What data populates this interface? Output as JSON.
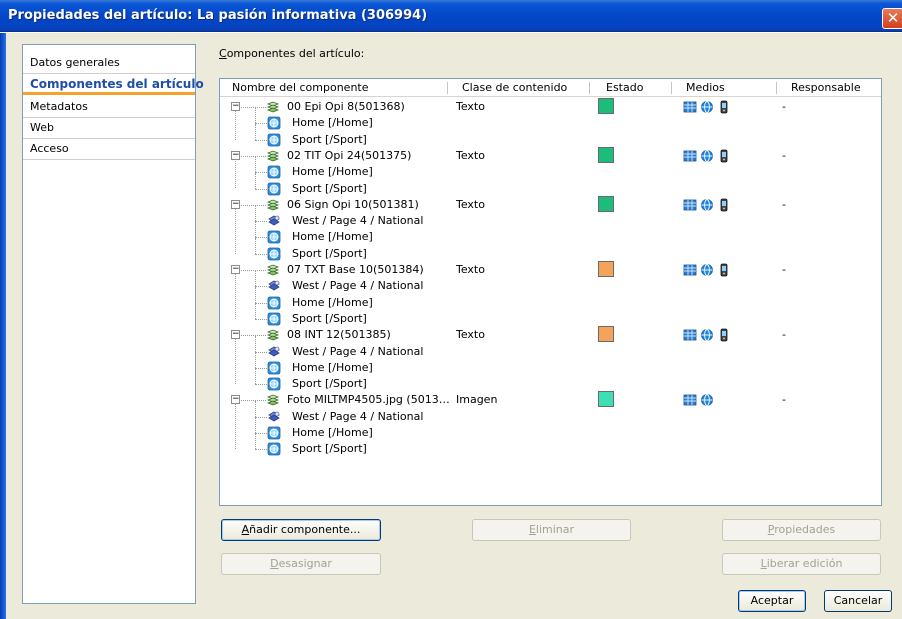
{
  "window": {
    "title": "Propiedades del artículo: La pasión informativa (306994)",
    "close_glyph": "✕"
  },
  "sidebar": {
    "items": [
      {
        "label": "Datos generales",
        "selected": false
      },
      {
        "label": "Componentes del artículo",
        "selected": true
      },
      {
        "label": "Metadatos",
        "selected": false
      },
      {
        "label": "Web",
        "selected": false
      },
      {
        "label": "Acceso",
        "selected": false
      }
    ]
  },
  "section": {
    "label_first": "C",
    "label_rest": "omponentes del artículo:"
  },
  "table": {
    "columns": [
      "Nombre del componente",
      "Clase de contenido",
      "Estado",
      "Medios",
      "Responsable"
    ],
    "rows": [
      {
        "type": "parent",
        "name": "00 Epi Opi 8(501368)",
        "content_class": "Texto",
        "status_color": "#1cbc7a",
        "media": [
          "grid-icon",
          "globe-icon",
          "mobile-icon"
        ],
        "responsable": "-"
      },
      {
        "type": "child",
        "name": "Home [/Home]",
        "icon": "web-icon"
      },
      {
        "type": "child",
        "name": "Sport [/Sport]",
        "icon": "web-icon"
      },
      {
        "type": "parent",
        "name": "02 TIT Opi 24(501375)",
        "content_class": "Texto",
        "status_color": "#1cbc7a",
        "media": [
          "grid-icon",
          "globe-icon",
          "mobile-icon"
        ],
        "responsable": "-"
      },
      {
        "type": "child",
        "name": "Home [/Home]",
        "icon": "web-icon"
      },
      {
        "type": "child",
        "name": "Sport [/Sport]",
        "icon": "web-icon"
      },
      {
        "type": "parent",
        "name": "06 Sign Opi 10(501381)",
        "content_class": "Texto",
        "status_color": "#1cbc7a",
        "media": [
          "grid-icon",
          "globe-icon",
          "mobile-icon"
        ],
        "responsable": "-"
      },
      {
        "type": "child",
        "name": "West / Page 4 / National",
        "icon": "page-icon"
      },
      {
        "type": "child",
        "name": "Home [/Home]",
        "icon": "web-icon"
      },
      {
        "type": "child",
        "name": "Sport [/Sport]",
        "icon": "web-icon"
      },
      {
        "type": "parent",
        "name": "07 TXT Base 10(501384)",
        "content_class": "Texto",
        "status_color": "#f4a35a",
        "media": [
          "grid-icon",
          "globe-icon",
          "mobile-icon"
        ],
        "responsable": "-"
      },
      {
        "type": "child",
        "name": "West / Page 4 / National",
        "icon": "page-icon"
      },
      {
        "type": "child",
        "name": "Home [/Home]",
        "icon": "web-icon"
      },
      {
        "type": "child",
        "name": "Sport [/Sport]",
        "icon": "web-icon"
      },
      {
        "type": "parent",
        "name": "08 INT 12(501385)",
        "content_class": "Texto",
        "status_color": "#f4a35a",
        "media": [
          "grid-icon",
          "globe-icon",
          "mobile-icon"
        ],
        "responsable": "-"
      },
      {
        "type": "child",
        "name": "West / Page 4 / National",
        "icon": "page-icon"
      },
      {
        "type": "child",
        "name": "Home [/Home]",
        "icon": "web-icon"
      },
      {
        "type": "child",
        "name": "Sport [/Sport]",
        "icon": "web-icon"
      },
      {
        "type": "parent",
        "name": "Foto MILTMP4505.jpg (5013…",
        "content_class": "Imagen",
        "status_color": "#3de0b4",
        "media": [
          "grid-icon",
          "globe-icon"
        ],
        "responsable": "-"
      },
      {
        "type": "child",
        "name": "West / Page 4 / National",
        "icon": "page-icon"
      },
      {
        "type": "child",
        "name": "Home [/Home]",
        "icon": "web-icon"
      },
      {
        "type": "child",
        "name": "Sport [/Sport]",
        "icon": "web-icon"
      }
    ]
  },
  "buttons": {
    "add_u": "A",
    "add_rest": "ñadir componente...",
    "delete_u": "E",
    "delete_rest": "liminar",
    "props_u": "P",
    "props_rest": "ropiedades",
    "unassign_u": "D",
    "unassign_rest": "esasignar",
    "release_u": "L",
    "release_rest": "iberar edición",
    "accept": "Aceptar",
    "cancel": "Cancelar"
  }
}
